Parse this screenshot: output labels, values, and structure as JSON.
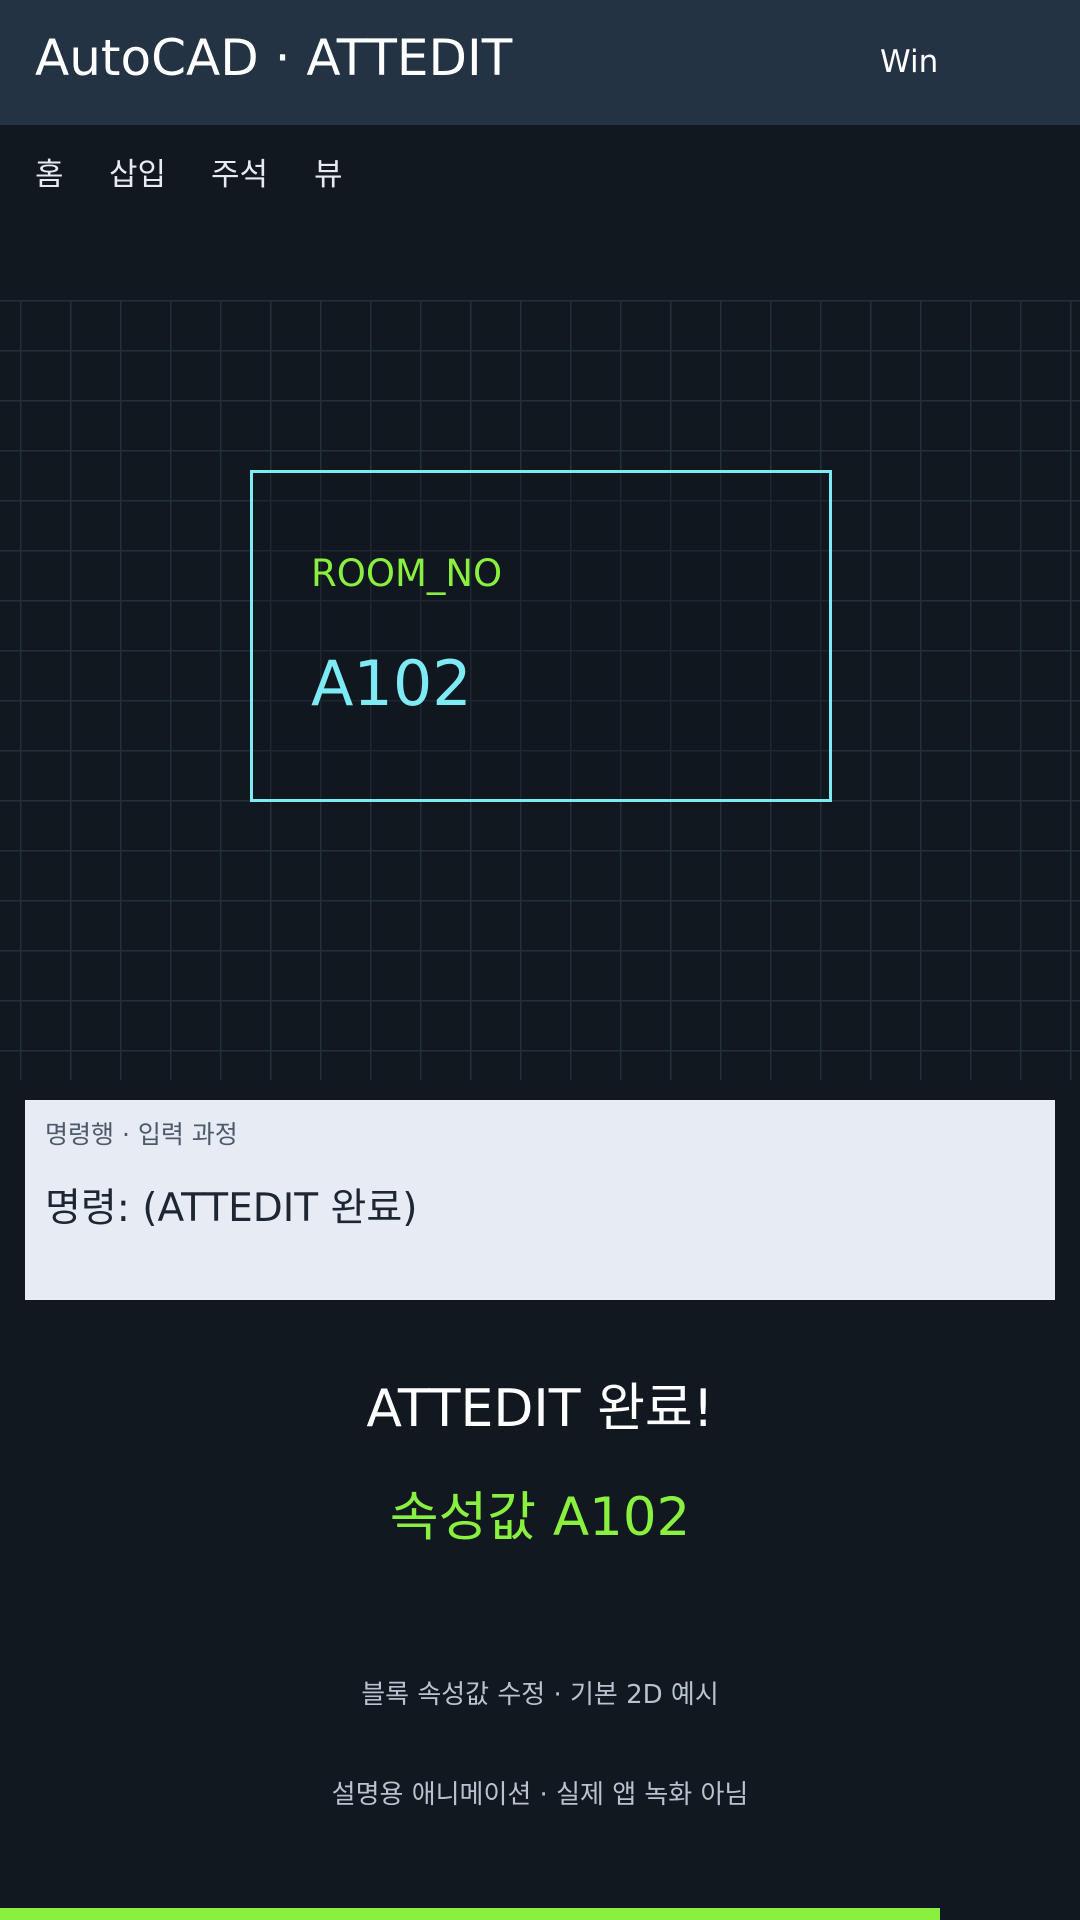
{
  "titlebar": {
    "title": "AutoCAD · ATTEDIT",
    "platform": "Win"
  },
  "ribbon": {
    "tabs": [
      {
        "label": "홈"
      },
      {
        "label": "삽입"
      },
      {
        "label": "주석"
      },
      {
        "label": "뷰"
      }
    ]
  },
  "drawing": {
    "block": {
      "attribute_tag": "ROOM_NO",
      "attribute_value": "A102"
    }
  },
  "command_panel": {
    "caption": "명령행 · 입력 과정",
    "line": "명령: (ATTEDIT 완료)"
  },
  "result": {
    "title": "ATTEDIT 완료!",
    "value_text": "속성값 A102"
  },
  "notes": [
    "블록 속성값 수정 · 기본 2D 예시",
    "설명용 애니메이션 · 실제 앱 녹화 아님"
  ],
  "progress": {
    "fraction": 0.87
  },
  "colors": {
    "background": "#111820",
    "titlebar": "#233344",
    "grid_line": "#223038",
    "block_outline": "#7eeaf4",
    "accent_green": "#8af03f",
    "panel_background": "#e6ebf4",
    "panel_text": "#1d2733"
  }
}
